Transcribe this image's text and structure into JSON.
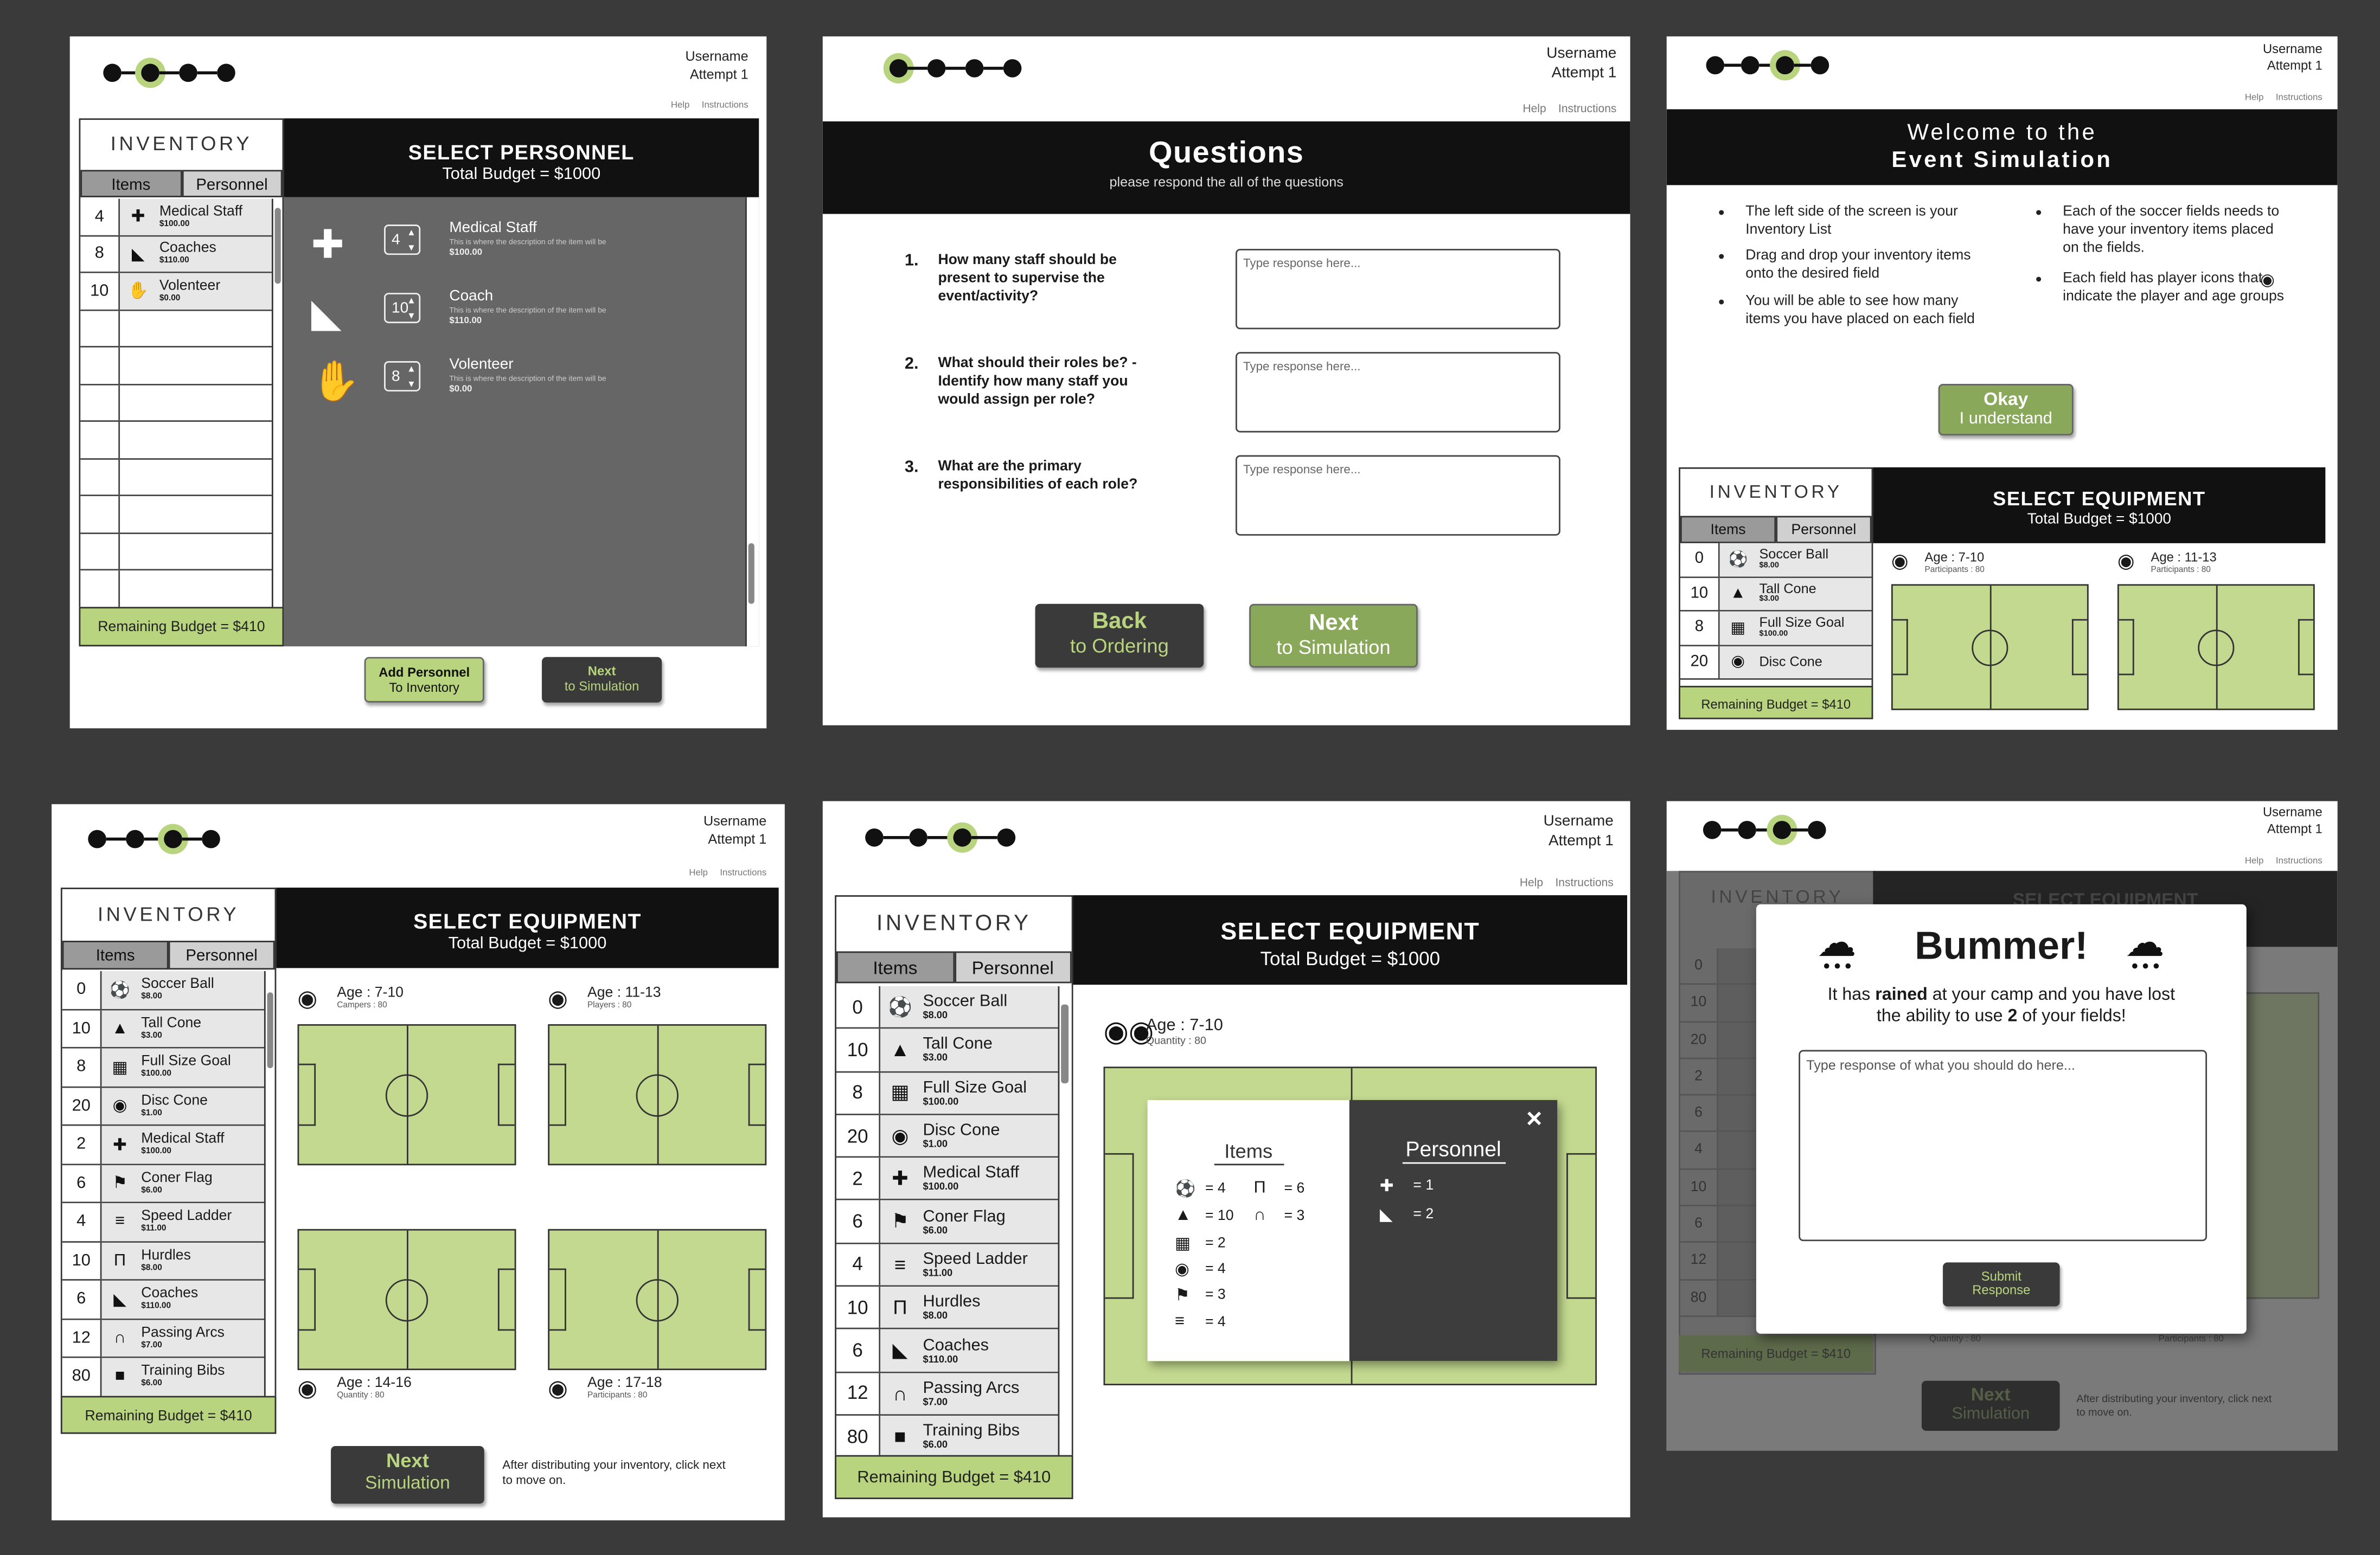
{
  "common": {
    "username": "Username",
    "attempt": "Attempt 1",
    "help": "Help",
    "instructions": "Instructions",
    "inventory_title": "INVENTORY",
    "tab_items": "Items",
    "tab_personnel": "Personnel",
    "remaining_budget": "Remaining Budget = $410",
    "select_equipment": "SELECT EQUIPMENT",
    "total_budget": "Total Budget = $1000"
  },
  "panel1": {
    "inventory_rows": [
      {
        "qty": "4",
        "name": "Medical Staff",
        "price": "$100.00",
        "icon": "medical-staff-icon"
      },
      {
        "qty": "8",
        "name": "Coaches",
        "price": "$110.00",
        "icon": "whistle-icon"
      },
      {
        "qty": "10",
        "name": "Volenteer",
        "price": "$0.00",
        "icon": "volunteer-icon"
      }
    ],
    "title": "SELECT PERSONNEL",
    "budget": "Total Budget = $1000",
    "personnel": [
      {
        "qty": "4",
        "name": "Medical Staff",
        "desc": "This is where the description of the item will be",
        "price": "$100.00",
        "icon": "medical-staff-icon"
      },
      {
        "qty": "10",
        "name": "Coach",
        "desc": "This is where the description of the item will be",
        "price": "$110.00",
        "icon": "whistle-icon"
      },
      {
        "qty": "8",
        "name": "Volenteer",
        "desc": "This is where the description of the item will be",
        "price": "$0.00",
        "icon": "volunteer-icon"
      }
    ],
    "add_btn_line1": "Add Personnel",
    "add_btn_line2": "To Inventory",
    "next_btn_line1": "Next",
    "next_btn_line2": "to Simulation"
  },
  "panel2": {
    "title": "Questions",
    "subtitle": "please respond the all of the questions",
    "questions": [
      {
        "num": "1.",
        "text": "How many staff should be present to supervise the event/activity?",
        "placeholder": "Type response here..."
      },
      {
        "num": "2.",
        "text": "What should their roles be? - Identify how many staff you would assign per role?",
        "placeholder": "Type response here..."
      },
      {
        "num": "3.",
        "text": "What are the primary responsibilities of each role?",
        "placeholder": "Type response here..."
      }
    ],
    "back_line1": "Back",
    "back_line2": "to Ordering",
    "next_line1": "Next",
    "next_line2": "to Simulation"
  },
  "panel3": {
    "title_line1": "Welcome to the",
    "title_line2": "Event Simulation",
    "bullets_left": [
      "The left side of the screen is your Inventory List",
      "Drag and drop your inventory items onto the desired field",
      "You will be able to see how many items you have placed on each field"
    ],
    "bullets_right": [
      "Each of the soccer fields needs to have your inventory items placed on the fields.",
      "Each field has player icons that indicate the player and age groups"
    ],
    "okay_line1": "Okay",
    "okay_line2": "I understand",
    "inventory_rows": [
      {
        "qty": "0",
        "name": "Soccer Ball",
        "price": "$8.00",
        "icon": "soccer-ball-icon"
      },
      {
        "qty": "10",
        "name": "Tall Cone",
        "price": "$3.00",
        "icon": "tall-cone-icon"
      },
      {
        "qty": "8",
        "name": "Full Size Goal",
        "price": "$100.00",
        "icon": "goal-icon"
      },
      {
        "qty": "20",
        "name": "Disc Cone",
        "price": "",
        "icon": "disc-cone-icon"
      }
    ],
    "fields": [
      {
        "age": "Age : 7-10",
        "sub": "Participants : 80"
      },
      {
        "age": "Age : 11-13",
        "sub": "Participants : 80"
      }
    ]
  },
  "panel4": {
    "inventory_rows": [
      {
        "qty": "0",
        "name": "Soccer Ball",
        "price": "$8.00",
        "icon": "soccer-ball-icon"
      },
      {
        "qty": "10",
        "name": "Tall Cone",
        "price": "$3.00",
        "icon": "tall-cone-icon"
      },
      {
        "qty": "8",
        "name": "Full Size Goal",
        "price": "$100.00",
        "icon": "goal-icon"
      },
      {
        "qty": "20",
        "name": "Disc Cone",
        "price": "$1.00",
        "icon": "disc-cone-icon"
      },
      {
        "qty": "2",
        "name": "Medical Staff",
        "price": "$100.00",
        "icon": "medical-staff-icon"
      },
      {
        "qty": "6",
        "name": "Coner Flag",
        "price": "$6.00",
        "icon": "flag-icon"
      },
      {
        "qty": "4",
        "name": "Speed Ladder",
        "price": "$11.00",
        "icon": "ladder-icon"
      },
      {
        "qty": "10",
        "name": "Hurdles",
        "price": "$8.00",
        "icon": "hurdle-icon"
      },
      {
        "qty": "6",
        "name": "Coaches",
        "price": "$110.00",
        "icon": "whistle-icon"
      },
      {
        "qty": "12",
        "name": "Passing Arcs",
        "price": "$7.00",
        "icon": "arc-icon"
      },
      {
        "qty": "80",
        "name": "Training Bibs",
        "price": "$6.00",
        "icon": "bib-icon"
      }
    ],
    "fields": [
      {
        "age": "Age : 7-10",
        "sub": "Campers : 80"
      },
      {
        "age": "Age : 11-13",
        "sub": "Players : 80"
      },
      {
        "age": "Age : 14-16",
        "sub": "Quantity : 80"
      },
      {
        "age": "Age : 17-18",
        "sub": "Participants : 80"
      }
    ],
    "next_line1": "Next",
    "next_line2": "Simulation",
    "note": "After distributing your inventory, click next to move on."
  },
  "panel5": {
    "field_age": "Age : 7-10",
    "field_sub": "Quantity : 80",
    "popup_items_title": "Items",
    "popup_personnel_title": "Personnel",
    "popup_items": [
      {
        "icon": "soccer-ball-icon",
        "count": "= 4"
      },
      {
        "icon": "hurdle-icon",
        "count": "= 6"
      },
      {
        "icon": "tall-cone-icon",
        "count": "= 10"
      },
      {
        "icon": "arc-icon",
        "count": "= 3"
      },
      {
        "icon": "goal-icon",
        "count": "= 2"
      },
      {
        "icon": "disc-cone-icon",
        "count": "= 4"
      },
      {
        "icon": "flag-icon",
        "count": "= 3"
      },
      {
        "icon": "ladder-icon",
        "count": "= 4"
      }
    ],
    "popup_personnel": [
      {
        "icon": "medical-staff-icon",
        "count": "= 1"
      },
      {
        "icon": "whistle-icon",
        "count": "= 2"
      }
    ]
  },
  "panel6": {
    "title": "Bummer!",
    "message_pre": "It has ",
    "message_bold": "rained",
    "message_mid": " at your camp and you have lost the ability to use ",
    "message_num": "2",
    "message_post": " of your fields!",
    "placeholder": "Type response of what you should do here...",
    "submit_line1": "Submit",
    "submit_line2": "Response",
    "bg_quantities": [
      "0",
      "10",
      "20",
      "2",
      "6",
      "4",
      "10",
      "6",
      "12",
      "80"
    ],
    "bg_next_line1": "Next",
    "bg_next_line2": "Simulation",
    "bg_note": "After distributing your inventory, click next to move on.",
    "bg_sub_left": "Quantity : 80",
    "bg_sub_right": "Participants : 80"
  }
}
